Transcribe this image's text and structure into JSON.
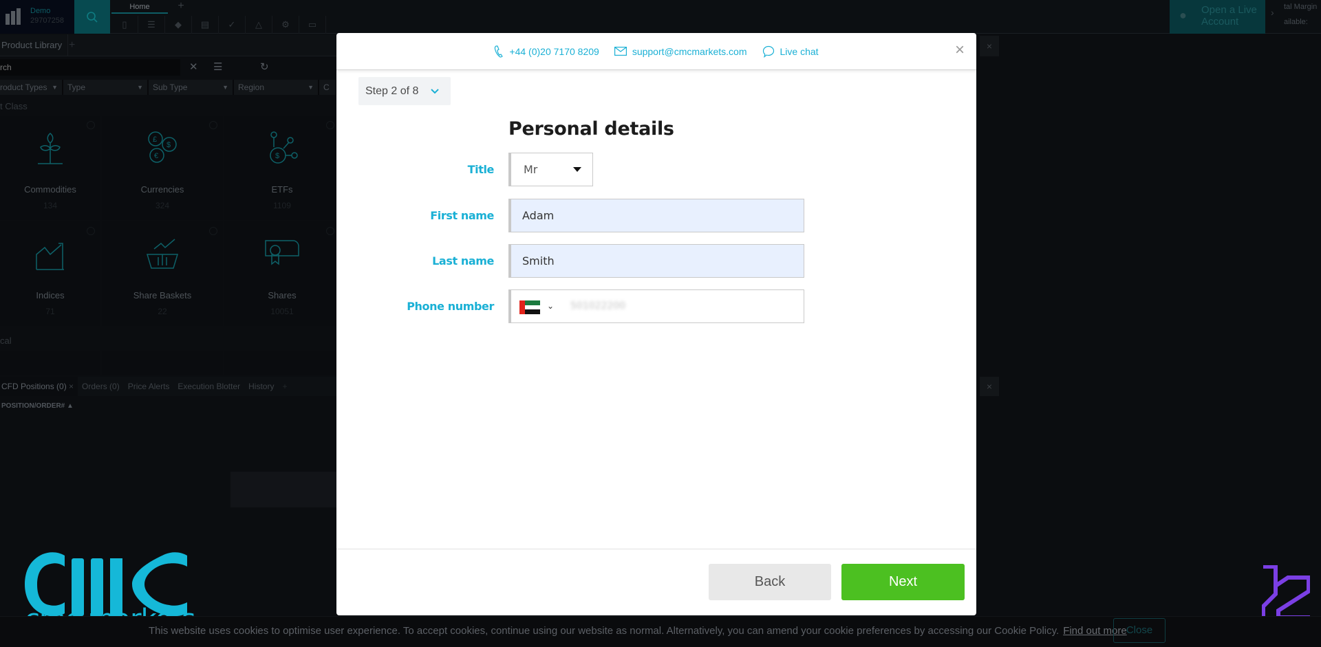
{
  "platform": {
    "account_type": "Demo",
    "account_number": "29707258",
    "home_tab": "Home",
    "open_live_account": "Open a Live Account",
    "total_margin_label": "tal Margin",
    "available_label": "ailable:",
    "toolbar_icons": [
      "bookmark-icon",
      "list-icon",
      "tag-icon",
      "document-icon",
      "chart-icon",
      "education-icon",
      "gear-icon",
      "window-icon"
    ],
    "product_library": {
      "tab_label": "Product Library",
      "search_placeholder": "rch",
      "filters": [
        "roduct Types",
        "Type",
        "Sub Type",
        "Region",
        "C"
      ],
      "section_asset_class": "t Class",
      "section_second": "cal",
      "tiles": [
        {
          "name": "Commodities",
          "count": "134",
          "icon": "plant-icon"
        },
        {
          "name": "Currencies",
          "count": "324",
          "icon": "coins-icon"
        },
        {
          "name": "ETFs",
          "count": "1109",
          "icon": "network-dollar-icon"
        },
        {
          "name": "Indices",
          "count": "71",
          "icon": "index-chart-icon"
        },
        {
          "name": "Share Baskets",
          "count": "22",
          "icon": "basket-icon"
        },
        {
          "name": "Shares",
          "count": "10051",
          "icon": "certificate-icon"
        }
      ]
    },
    "bottom_tabs": [
      "CFD Positions (0)",
      "Orders (0)",
      "Price Alerts",
      "Execution Blotter",
      "History"
    ],
    "column_header": "POSITION/ORDER#"
  },
  "modal": {
    "phone": "+44 (0)20 7170 8209",
    "email": "support@cmcmarkets.com",
    "live_chat": "Live chat",
    "step": "Step 2 of 8",
    "title": "Personal details",
    "fields": {
      "title_label": "Title",
      "title_value": "Mr",
      "first_name_label": "First name",
      "first_name_value": "Adam",
      "last_name_label": "Last name",
      "last_name_value": "Smith",
      "phone_label": "Phone number",
      "phone_country": "AE",
      "phone_value": "501022200"
    },
    "back_label": "Back",
    "next_label": "Next",
    "colors": {
      "accent": "#1ab0d5",
      "next": "#4cc021",
      "autofill": "#e8f0fe"
    }
  },
  "cookie": {
    "text": "This website uses cookies to optimise user experience. To accept cookies, continue using our website as normal. Alternatively, you can amend your cookie preferences by accessing our Cookie Policy.",
    "link": "Find out more",
    "close": "Close"
  },
  "branding": {
    "cmc_wordmark": "cmc markets"
  }
}
